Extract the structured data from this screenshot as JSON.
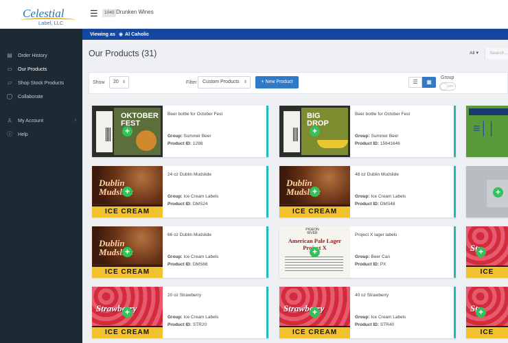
{
  "app": {
    "logo_text": "Celestial",
    "logo_sub": "Label, LLC",
    "account_badge": "1040",
    "account_name": "Drunken Wines"
  },
  "viewing": {
    "label": "Viewing as",
    "user": "Al Caholic"
  },
  "sidebar": {
    "items": [
      {
        "label": "Order History",
        "icon": "history-icon"
      },
      {
        "label": "Our Products",
        "icon": "clipboard-icon",
        "active": true
      },
      {
        "label": "Shop Stock Products",
        "icon": "cart-icon"
      },
      {
        "label": "Collaborate",
        "icon": "chat-icon"
      },
      {
        "label": "My Account",
        "icon": "user-icon"
      },
      {
        "label": "Help",
        "icon": "info-icon"
      }
    ]
  },
  "main": {
    "title": "Our Products (31)",
    "all_label": "All",
    "search_placeholder": "Search..."
  },
  "toolbar": {
    "show_label": "Show",
    "show_value": "20",
    "filter_label": "Filter",
    "filter_value": "Custom Products",
    "new_button": "+ New Product",
    "group_label": "Group",
    "toggle_text": "OFF"
  },
  "products": [
    {
      "name": "Beer bottle for October Fest",
      "group_key": "Group:",
      "group": "Summer Beer",
      "pid_key": "Product ID:",
      "pid": "1298",
      "thumb": "oktober",
      "thumb_text": "OKTOBER FEST"
    },
    {
      "name": "Beer bottle for October Fest",
      "group_key": "Group:",
      "group": "Summer Beer",
      "pid_key": "Product ID:",
      "pid": "15641646",
      "thumb": "bigdrop",
      "thumb_text": "BIG DROP"
    },
    {
      "name": "24 oz Dublin Mudslide",
      "group_key": "Group:",
      "group": "Ice Cream Labels",
      "pid_key": "Product ID:",
      "pid": "DMS24",
      "thumb": "dublin",
      "thumb_text": "Dublin Mudslide"
    },
    {
      "name": "48 oz Dublin Mudslide",
      "group_key": "Group:",
      "group": "Ice Cream Labels",
      "pid_key": "Product ID:",
      "pid": "DMS48",
      "thumb": "dublin",
      "thumb_text": "Dublin Mudslide"
    },
    {
      "name": "66 oz Dublin Mudslide",
      "group_key": "Group:",
      "group": "Ice Cream Labels",
      "pid_key": "Product ID:",
      "pid": "DMS66",
      "thumb": "dublin",
      "thumb_text": "Dublin Mudslide"
    },
    {
      "name": "Project X lager labels",
      "group_key": "Group:",
      "group": "Beer Can",
      "pid_key": "Product ID:",
      "pid": "PX",
      "thumb": "projx",
      "thumb_text": "American Pale Lager Project X"
    },
    {
      "name": "20 oz Strawberry",
      "group_key": "Group:",
      "group": "Ice Cream Labels",
      "pid_key": "Product ID:",
      "pid": "STR20",
      "thumb": "straw",
      "thumb_text": "Strawberry"
    },
    {
      "name": "40 oz Strawberry",
      "group_key": "Group:",
      "group": "Ice Cream Labels",
      "pid_key": "Product ID:",
      "pid": "STR40",
      "thumb": "straw",
      "thumb_text": "Strawberry"
    }
  ],
  "thumb_labels": {
    "ice_cream": "ICE CREAM",
    "projx_brand": "PIGEON RIVER"
  },
  "colors": {
    "sidebar_bg": "#1e2a33",
    "viewbar_bg": "#1448a0",
    "primary_button": "#2f79c6",
    "card_accent": "#23b9b6",
    "add_icon": "#33c25a"
  }
}
